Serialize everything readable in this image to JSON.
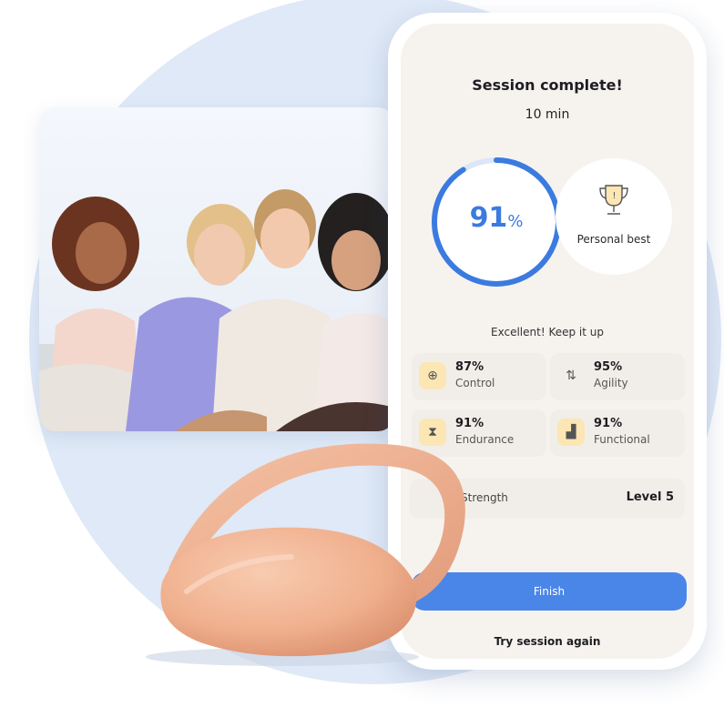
{
  "session": {
    "title": "Session complete!",
    "duration": "10 min",
    "score_value": "91",
    "score_unit": "%",
    "score_fraction": 0.91,
    "personal_best_label": "Personal best",
    "encouragement": "Excellent! Keep it up"
  },
  "stats": [
    {
      "value": "87%",
      "label": "Control",
      "icon": "crosshair-icon"
    },
    {
      "value": "95%",
      "label": "Agility",
      "icon": "up-down-arrows-icon"
    },
    {
      "value": "91%",
      "label": "Endurance",
      "icon": "hourglass-icon"
    },
    {
      "value": "91%",
      "label": "Functional",
      "icon": "stairs-icon"
    }
  ],
  "strength": {
    "label": "Strength",
    "value": "Level 5"
  },
  "actions": {
    "finish_label": "Finish",
    "retry_label": "Try session again"
  },
  "colors": {
    "accent": "#4a86e8",
    "ring": "#3b7be0",
    "ring_track": "#dbe6f7",
    "icon_bg": "#fbe6b4",
    "screen_bg": "#f6f3ef",
    "background_circle": "#dfe9f7",
    "device": "#f2b591"
  }
}
